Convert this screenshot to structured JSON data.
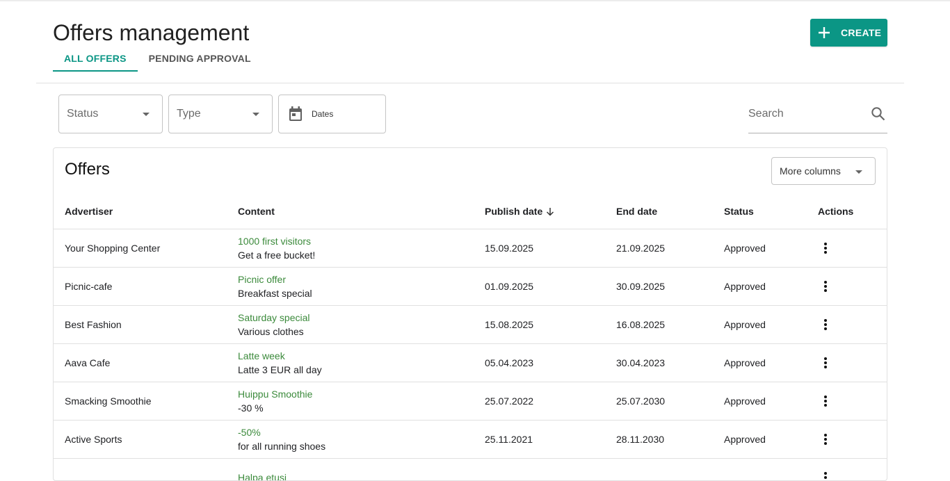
{
  "header": {
    "title": "Offers management",
    "create_label": "CREATE",
    "tabs": [
      {
        "label": "ALL OFFERS",
        "active": true
      },
      {
        "label": "PENDING APPROVAL",
        "active": false
      }
    ]
  },
  "filters": {
    "status_placeholder": "Status",
    "type_placeholder": "Type",
    "dates_label": "Dates",
    "search_placeholder": "Search"
  },
  "offers": {
    "title": "Offers",
    "more_columns_label": "More columns",
    "columns": {
      "advertiser": "Advertiser",
      "content": "Content",
      "publish_date": "Publish date",
      "end_date": "End date",
      "status": "Status",
      "actions": "Actions"
    },
    "rows": [
      {
        "advertiser": "Your Shopping Center",
        "content_title": "1000 first visitors",
        "content_desc": "Get a free bucket!",
        "publish_date": "15.09.2025",
        "end_date": "21.09.2025",
        "status": "Approved"
      },
      {
        "advertiser": "Picnic-cafe",
        "content_title": "Picnic offer",
        "content_desc": "Breakfast special",
        "publish_date": "01.09.2025",
        "end_date": "30.09.2025",
        "status": "Approved"
      },
      {
        "advertiser": "Best Fashion",
        "content_title": "Saturday special",
        "content_desc": "Various clothes",
        "publish_date": "15.08.2025",
        "end_date": "16.08.2025",
        "status": "Approved"
      },
      {
        "advertiser": "Aava Cafe",
        "content_title": "Latte week",
        "content_desc": "Latte 3 EUR all day",
        "publish_date": "05.04.2023",
        "end_date": "30.04.2023",
        "status": "Approved"
      },
      {
        "advertiser": "Smacking Smoothie",
        "content_title": "Huippu Smoothie",
        "content_desc": "-30 %",
        "publish_date": "25.07.2022",
        "end_date": "25.07.2030",
        "status": "Approved"
      },
      {
        "advertiser": "Active Sports",
        "content_title": "-50%",
        "content_desc": "for all running shoes",
        "publish_date": "25.11.2021",
        "end_date": "28.11.2030",
        "status": "Approved"
      },
      {
        "advertiser": "",
        "content_title": "Halpa etusi",
        "content_desc": "",
        "publish_date": "",
        "end_date": "",
        "status": ""
      }
    ]
  },
  "colors": {
    "accent": "#0b9685",
    "content_title": "#3b8a3b"
  },
  "icons": {
    "create": "plus-icon",
    "dates": "calendar-icon",
    "search": "search-icon",
    "dropdown": "caret-down-icon",
    "sort": "arrow-down-icon",
    "row_actions": "more-vert-icon"
  }
}
